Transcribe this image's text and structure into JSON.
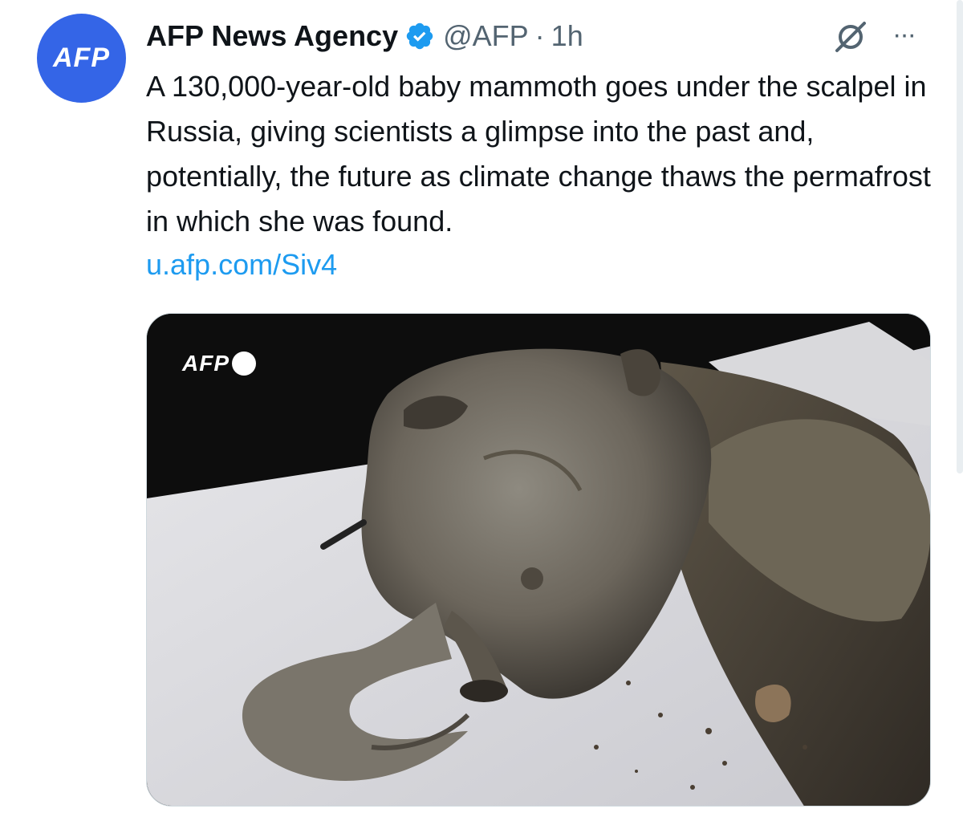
{
  "author": {
    "avatar_text": "AFP",
    "display_name": "AFP News Agency",
    "handle": "@AFP",
    "separator": "·",
    "time": "1h",
    "verified_icon": "verified-badge-icon"
  },
  "tweet": {
    "text": "A 130,000-year-old baby mammoth goes under the scalpel in Russia, giving scientists a glimpse into the past and, potentially, the future as climate change thaws the permafrost in which she was found.",
    "link": "u.afp.com/Siv4"
  },
  "media": {
    "watermark": "AFP"
  },
  "actions": {
    "grok_icon": "grok-icon",
    "more_icon": "more-icon",
    "more_glyph": "···"
  },
  "colors": {
    "accent": "#1d9bf0",
    "avatar_bg": "#3465e7",
    "secondary_text": "#536471"
  }
}
